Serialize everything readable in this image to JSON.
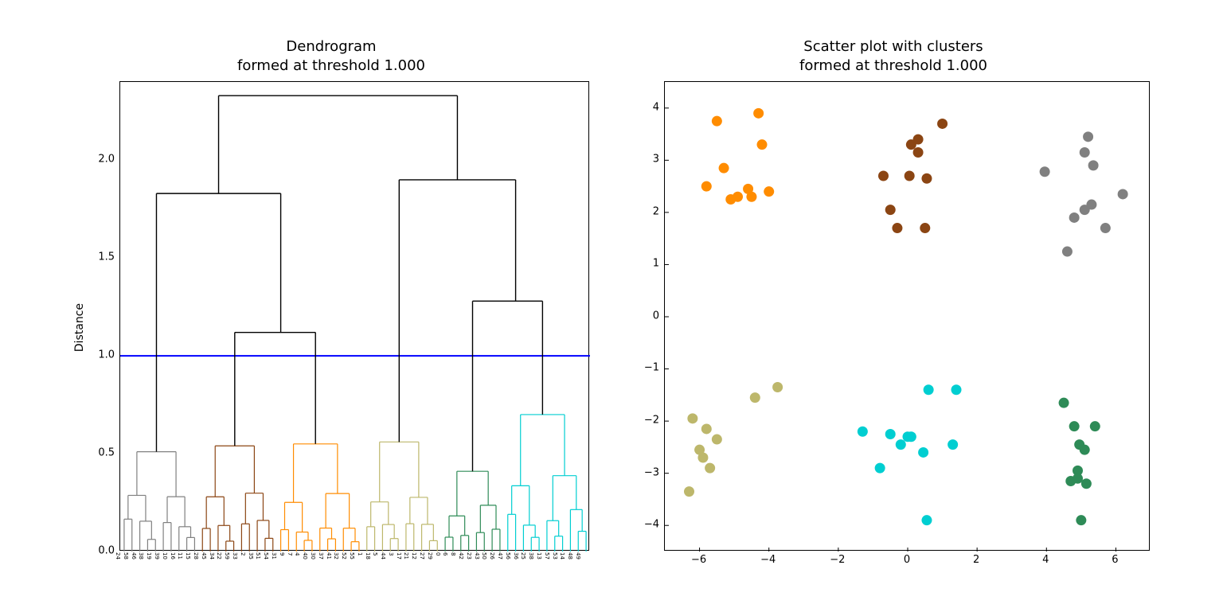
{
  "chart_data": [
    {
      "type": "dendrogram",
      "title": "Dendrogram\nformed at threshold 1.000",
      "ylabel": "Distance",
      "ylim": [
        0.0,
        2.4
      ],
      "yticks": [
        0.0,
        0.5,
        1.0,
        1.5,
        2.0
      ],
      "threshold_line": 1.0,
      "leaf_labels": [
        24,
        58,
        46,
        38,
        19,
        39,
        10,
        16,
        11,
        15,
        28,
        45,
        34,
        22,
        59,
        33,
        2,
        35,
        51,
        54,
        31,
        9,
        7,
        4,
        40,
        30,
        37,
        41,
        32,
        52,
        55,
        1,
        18,
        5,
        44,
        3,
        17,
        21,
        12,
        27,
        29,
        0,
        6,
        8,
        42,
        23,
        43,
        50,
        26,
        47,
        56,
        36,
        25,
        38,
        13,
        57,
        53,
        14,
        48,
        49
      ],
      "clusters": [
        {
          "color": "#808080",
          "range": [
            0,
            10
          ],
          "top": 0.51
        },
        {
          "color": "#8b4513",
          "range": [
            10,
            20
          ],
          "top": 0.54
        },
        {
          "color": "#ff8c00",
          "range": [
            20,
            31
          ],
          "top": 0.55
        },
        {
          "color": "#bdb76b",
          "range": [
            31,
            41
          ],
          "top": 0.56
        },
        {
          "color": "#2e8b57",
          "range": [
            41,
            49
          ],
          "top": 0.41
        },
        {
          "color": "#00ced1",
          "range": [
            49,
            60
          ],
          "top": 0.7
        }
      ],
      "merges_black": [
        {
          "left_range": [
            0,
            10
          ],
          "left_h": 0.51,
          "right_range": [
            10,
            31
          ],
          "right_h": 1.12,
          "height": 1.83
        },
        {
          "left_range": [
            10,
            20
          ],
          "left_h": 0.54,
          "right_range": [
            20,
            31
          ],
          "right_h": 0.55,
          "height": 1.12
        },
        {
          "left_range": [
            31,
            41
          ],
          "left_h": 0.56,
          "right_range": [
            41,
            60
          ],
          "right_h": 1.28,
          "height": 1.9
        },
        {
          "left_range": [
            41,
            49
          ],
          "left_h": 0.41,
          "right_range": [
            49,
            60
          ],
          "right_h": 0.7,
          "height": 1.28
        },
        {
          "left_range": [
            0,
            31
          ],
          "left_h": 1.83,
          "right_range": [
            31,
            60
          ],
          "right_h": 1.9,
          "height": 2.33
        }
      ]
    },
    {
      "type": "scatter",
      "title": "Scatter plot with clusters\nformed at threshold 1.000",
      "xlim": [
        -7,
        7
      ],
      "ylim": [
        -4.5,
        4.5
      ],
      "xticks": [
        -6,
        -4,
        -2,
        0,
        2,
        4,
        6
      ],
      "yticks": [
        -4,
        -3,
        -2,
        -1,
        0,
        1,
        2,
        3,
        4
      ],
      "series": [
        {
          "name": "cluster-orange",
          "color": "#ff8c00",
          "points": [
            [
              -5.8,
              2.5
            ],
            [
              -5.5,
              3.75
            ],
            [
              -5.3,
              2.85
            ],
            [
              -5.1,
              2.25
            ],
            [
              -4.9,
              2.3
            ],
            [
              -4.6,
              2.45
            ],
            [
              -4.5,
              2.3
            ],
            [
              -4.3,
              3.9
            ],
            [
              -4.2,
              3.3
            ],
            [
              -4.0,
              2.4
            ]
          ]
        },
        {
          "name": "cluster-brown",
          "color": "#8b4513",
          "points": [
            [
              -0.7,
              2.7
            ],
            [
              -0.5,
              2.05
            ],
            [
              -0.3,
              1.7
            ],
            [
              0.05,
              2.7
            ],
            [
              0.1,
              3.3
            ],
            [
              0.3,
              3.15
            ],
            [
              0.3,
              3.4
            ],
            [
              0.5,
              1.7
            ],
            [
              0.55,
              2.65
            ],
            [
              1.0,
              3.7
            ]
          ]
        },
        {
          "name": "cluster-gray",
          "color": "#808080",
          "points": [
            [
              3.95,
              2.78
            ],
            [
              4.6,
              1.25
            ],
            [
              4.8,
              1.9
            ],
            [
              5.1,
              3.15
            ],
            [
              5.1,
              2.05
            ],
            [
              5.2,
              3.45
            ],
            [
              5.3,
              2.15
            ],
            [
              5.35,
              2.9
            ],
            [
              5.7,
              1.7
            ],
            [
              6.2,
              2.35
            ]
          ]
        },
        {
          "name": "cluster-olive",
          "color": "#bdb76b",
          "points": [
            [
              -6.3,
              -3.35
            ],
            [
              -6.2,
              -1.95
            ],
            [
              -6.0,
              -2.55
            ],
            [
              -5.9,
              -2.7
            ],
            [
              -5.8,
              -2.15
            ],
            [
              -5.7,
              -2.9
            ],
            [
              -5.5,
              -2.35
            ],
            [
              -4.4,
              -1.55
            ],
            [
              -3.75,
              -1.35
            ]
          ]
        },
        {
          "name": "cluster-cyan",
          "color": "#00ced1",
          "points": [
            [
              -1.3,
              -2.2
            ],
            [
              -0.8,
              -2.9
            ],
            [
              -0.5,
              -2.25
            ],
            [
              -0.2,
              -2.45
            ],
            [
              0.0,
              -2.3
            ],
            [
              0.1,
              -2.3
            ],
            [
              0.45,
              -2.6
            ],
            [
              0.55,
              -3.9
            ],
            [
              0.6,
              -1.4
            ],
            [
              1.3,
              -2.45
            ],
            [
              1.4,
              -1.4
            ]
          ]
        },
        {
          "name": "cluster-green",
          "color": "#2e8b57",
          "points": [
            [
              4.5,
              -1.65
            ],
            [
              4.7,
              -3.15
            ],
            [
              4.8,
              -2.1
            ],
            [
              4.9,
              -2.95
            ],
            [
              4.9,
              -3.1
            ],
            [
              4.95,
              -2.45
            ],
            [
              5.0,
              -3.9
            ],
            [
              5.1,
              -2.55
            ],
            [
              5.15,
              -3.2
            ],
            [
              5.4,
              -2.1
            ]
          ]
        }
      ]
    }
  ]
}
